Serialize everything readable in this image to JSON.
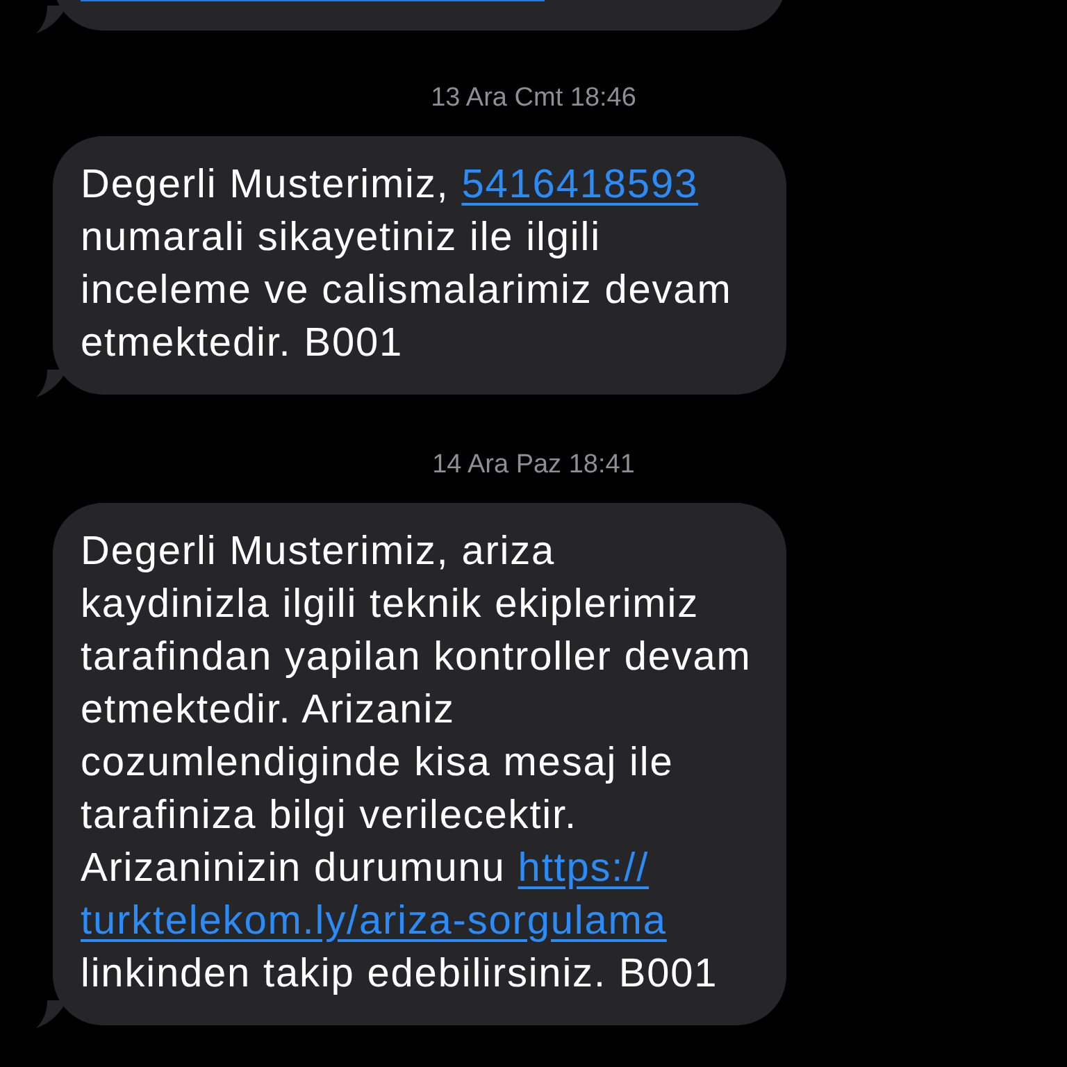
{
  "messages": [
    {
      "kind": "partial"
    },
    {
      "kind": "timestamp",
      "text": "13 Ara Cmt 18:46"
    },
    {
      "kind": "bubble",
      "segments": [
        {
          "kind": "text",
          "text": "Degerli Musterimiz, "
        },
        {
          "kind": "link",
          "text": "5416418593"
        },
        {
          "kind": "text",
          "text": " numarali sikayetiniz ile ilgili inceleme ve calismalarimiz devam etmektedir. B001"
        }
      ]
    },
    {
      "kind": "timestamp",
      "text": "14 Ara Paz 18:41"
    },
    {
      "kind": "bubble",
      "segments": [
        {
          "kind": "text",
          "text": "Degerli Musterimiz, ariza kaydinizla ilgili teknik ekiplerimiz tarafindan yapilan kontroller devam etmektedir. Arizaniz cozumlendiginde kisa mesaj ile tarafiniza bilgi verilecektir. Arizaninizin durumunu "
        },
        {
          "kind": "link",
          "text": "https://"
        },
        {
          "kind": "link",
          "text": "turktelekom.ly/ariza-sorgulama"
        },
        {
          "kind": "text",
          "text": " linkinden takip edebilirsiniz. B001"
        }
      ]
    }
  ]
}
